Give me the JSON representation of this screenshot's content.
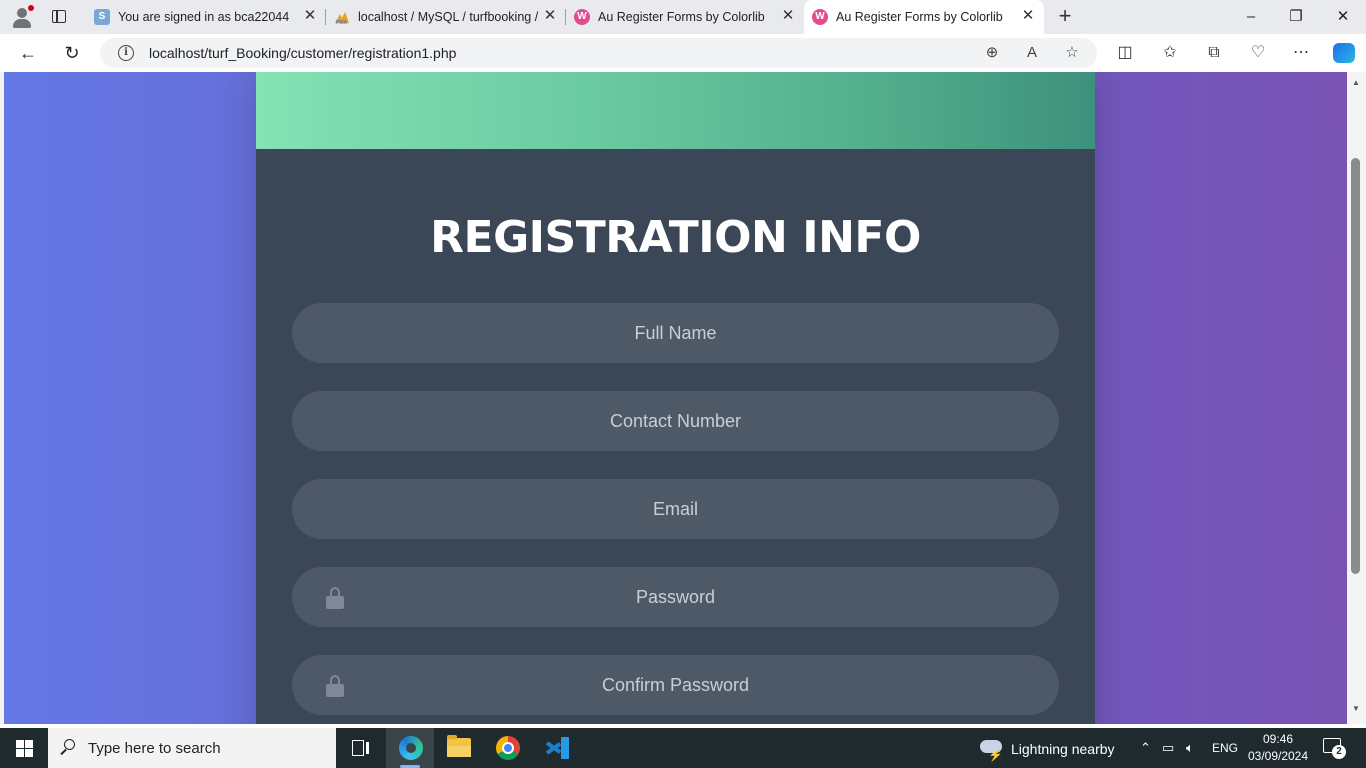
{
  "browser": {
    "tabs": [
      {
        "title": "You are signed in as bca22044",
        "favicon": "s-icon"
      },
      {
        "title": "localhost / MySQL / turfbooking /",
        "favicon": "phpmyadmin-icon"
      },
      {
        "title": "Au Register Forms by Colorlib",
        "favicon": "au-icon"
      },
      {
        "title": "Au Register Forms by Colorlib",
        "favicon": "au-icon",
        "active": true
      }
    ],
    "url": "localhost/turf_Booking/customer/registration1.php"
  },
  "page": {
    "title": "REGISTRATION INFO",
    "fields": {
      "full_name": "Full Name",
      "contact": "Contact Number",
      "email": "Email",
      "password": "Password",
      "confirm_password": "Confirm Password"
    },
    "colors": {
      "card": "#3b4757",
      "field": "#4e5968",
      "header_start": "#84e2b4",
      "header_end": "#3e917c",
      "bg_start": "#6478e6",
      "bg_end": "#7853b4"
    }
  },
  "taskbar": {
    "search_placeholder": "Type here to search",
    "weather": "Lightning nearby",
    "language": "ENG",
    "time": "09:46",
    "date": "03/09/2024",
    "notifications": "2"
  }
}
